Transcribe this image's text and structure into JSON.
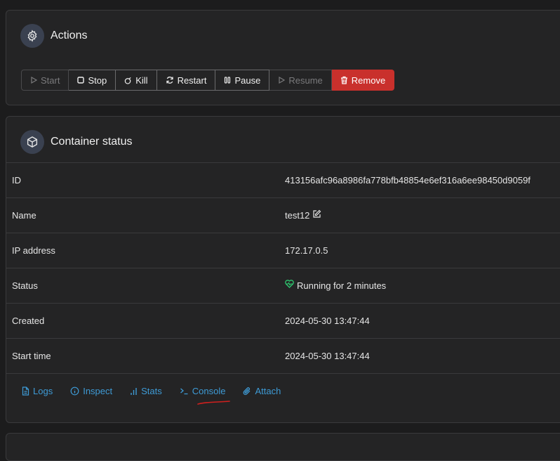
{
  "actions": {
    "title": "Actions",
    "icon": "gear-icon",
    "buttons": [
      {
        "label": "Start",
        "icon": "play-icon",
        "disabled": true
      },
      {
        "label": "Stop",
        "icon": "stop-icon",
        "disabled": false
      },
      {
        "label": "Kill",
        "icon": "bomb-icon",
        "disabled": false
      },
      {
        "label": "Restart",
        "icon": "refresh-icon",
        "disabled": false
      },
      {
        "label": "Pause",
        "icon": "pause-icon",
        "disabled": false
      },
      {
        "label": "Resume",
        "icon": "play-icon",
        "disabled": true
      },
      {
        "label": "Remove",
        "icon": "trash-icon",
        "disabled": false,
        "color": "#c9302c"
      }
    ]
  },
  "status": {
    "title": "Container status",
    "icon": "cube-icon",
    "rows": [
      {
        "label": "ID",
        "value": "413156afc96a8986fa778bfb48854e6ef316a6ee98450d9059f"
      },
      {
        "label": "Name",
        "value": "test12"
      },
      {
        "label": "IP address",
        "value": "172.17.0.5"
      },
      {
        "label": "Status",
        "value": "Running for 2 minutes"
      },
      {
        "label": "Created",
        "value": "2024-05-30 13:47:44"
      },
      {
        "label": "Start time",
        "value": "2024-05-30 13:47:44"
      }
    ],
    "links": [
      {
        "label": "Logs",
        "icon": "file-icon"
      },
      {
        "label": "Inspect",
        "icon": "info-icon"
      },
      {
        "label": "Stats",
        "icon": "bar-chart-icon"
      },
      {
        "label": "Console",
        "icon": "terminal-icon"
      },
      {
        "label": "Attach",
        "icon": "paperclip-icon"
      }
    ]
  },
  "colors": {
    "accent_link": "#3e9bd6",
    "danger": "#c9302c",
    "status_ok": "#2ecc71",
    "annotation": "#d0201e"
  }
}
